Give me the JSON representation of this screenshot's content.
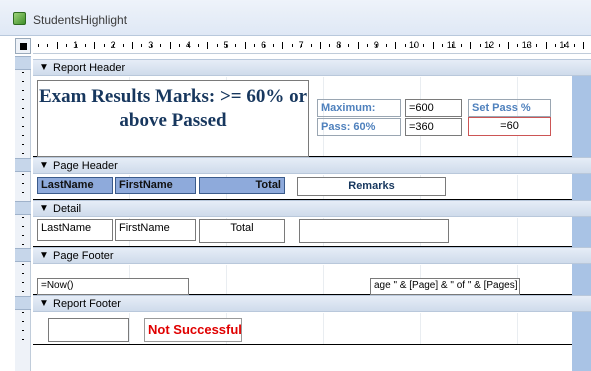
{
  "window": {
    "title": "StudentsHighlight"
  },
  "ruler": {
    "numbers": [
      "1",
      "2",
      "3",
      "4",
      "5",
      "6",
      "7",
      "8",
      "9",
      "10",
      "11",
      "12",
      "13",
      "14"
    ]
  },
  "sections": {
    "report_header": "Report Header",
    "page_header": "Page Header",
    "detail": "Detail",
    "page_footer": "Page Footer",
    "report_footer": "Report Footer"
  },
  "report_header": {
    "title": "Exam Results Marks: >= 60% or above Passed",
    "maximum_label": "Maximum:",
    "maximum_value": "=600",
    "pass_label": "Pass: 60%",
    "pass_value": "=360",
    "set_pass_label": "Set Pass %",
    "set_pass_value": "=60"
  },
  "page_header": {
    "lastname": "LastName",
    "firstname": "FirstName",
    "total": "Total",
    "remarks": "Remarks"
  },
  "detail": {
    "lastname": "LastName",
    "firstname": "FirstName",
    "total": "Total",
    "remarks": ""
  },
  "page_footer": {
    "date_expr": "=Now()",
    "page_expr": "age \" & [Page] & \" of \" & [Pages]"
  },
  "report_footer": {
    "empty_box": "",
    "not_successful": "Not Successful"
  },
  "colors": {
    "title_blue": "#17375e",
    "label_blue": "#4f81bd",
    "header_fill": "#8eaadb",
    "fail_red": "#e00000"
  }
}
